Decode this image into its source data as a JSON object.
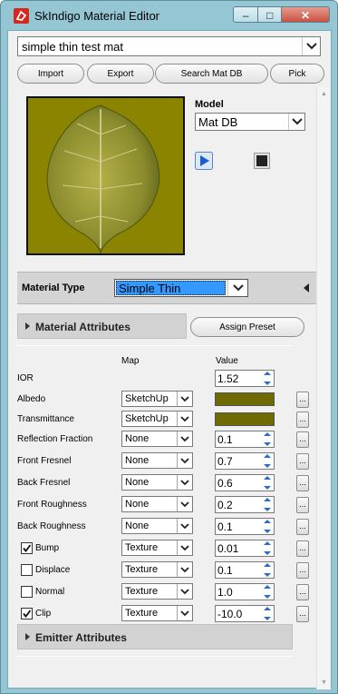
{
  "window": {
    "title": "SkIndigo Material Editor",
    "min_glyph": "–",
    "max_glyph": "□",
    "close_glyph": "✕"
  },
  "material_select": {
    "value": "simple thin test mat"
  },
  "toolbar": {
    "import_label": "Import",
    "export_label": "Export",
    "search_label": "Search Mat DB",
    "pick_label": "Pick"
  },
  "model": {
    "label": "Model",
    "value": "Mat DB"
  },
  "material_type": {
    "label": "Material Type",
    "value": "Simple Thin"
  },
  "sections": {
    "material_attributes": "Material Attributes",
    "assign_preset": "Assign Preset",
    "emitter_attributes": "Emitter Attributes"
  },
  "columns": {
    "map": "Map",
    "value": "Value"
  },
  "attributes": [
    {
      "label": "IOR",
      "value": "1.52"
    },
    {
      "label": "Albedo",
      "map": "SketchUp",
      "swatch": "#6f6a02",
      "more": "..."
    },
    {
      "label": "Transmittance",
      "map": "SketchUp",
      "swatch": "#6f6a02",
      "more": "..."
    },
    {
      "label": "Reflection Fraction",
      "map": "None",
      "value": "0.1",
      "more": "..."
    },
    {
      "label": "Front Fresnel",
      "map": "None",
      "value": "0.7",
      "more": "..."
    },
    {
      "label": "Back Fresnel",
      "map": "None",
      "value": "0.6",
      "more": "..."
    },
    {
      "label": "Front Roughness",
      "map": "None",
      "value": "0.2",
      "more": "..."
    },
    {
      "label": "Back Roughness",
      "map": "None",
      "value": "0.1",
      "more": "..."
    },
    {
      "label": "Bump",
      "checked": true,
      "map": "Texture",
      "value": "0.01",
      "more": "..."
    },
    {
      "label": "Displace",
      "checked": false,
      "map": "Texture",
      "value": "0.1",
      "more": "..."
    },
    {
      "label": "Normal",
      "checked": false,
      "map": "Texture",
      "value": "1.0",
      "more": "..."
    },
    {
      "label": "Clip",
      "checked": true,
      "map": "Texture",
      "value": "-10.0",
      "more": "..."
    }
  ]
}
